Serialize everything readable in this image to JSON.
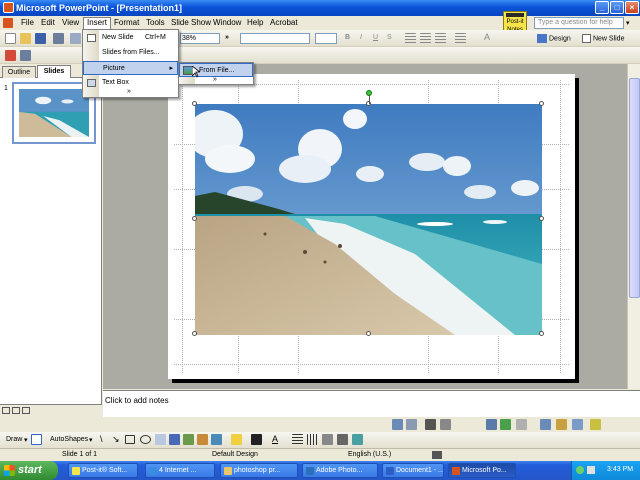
{
  "window": {
    "title": "Microsoft PowerPoint - [Presentation1]",
    "buttons": {
      "minimize": "_",
      "maximize": "□",
      "close": "×"
    }
  },
  "menubar": {
    "items": [
      "File",
      "Edit",
      "View",
      "Insert",
      "Format",
      "Tools",
      "Slide Show",
      "Window",
      "Help",
      "Acrobat"
    ],
    "active": "Insert",
    "help_placeholder": "Type a question for help",
    "postit_label": "Post-it Notes"
  },
  "toolbar": {
    "zoom": "38%",
    "design_label": "Design",
    "new_slide_label": "New Slide"
  },
  "insert_menu": {
    "items": [
      {
        "label": "New Slide",
        "shortcut": "Ctrl+M"
      },
      {
        "label": "Slides from Files...",
        "shortcut": ""
      },
      {
        "label": "Picture",
        "shortcut": ""
      },
      {
        "label": "Text Box",
        "shortcut": ""
      }
    ],
    "expand_glyph": "»"
  },
  "picture_submenu": {
    "items": [
      {
        "label": "From File..."
      }
    ],
    "expand_glyph": "»"
  },
  "left_pane": {
    "tabs": [
      "Outline",
      "Slides"
    ],
    "active_tab": "Slides",
    "close_glyph": "×",
    "slide_number": "1"
  },
  "notes": {
    "placeholder": "Click to add notes"
  },
  "drawing_toolbar": {
    "draw_label": "Draw",
    "autoshapes_label": "AutoShapes"
  },
  "statusbar": {
    "slide_info": "Slide 1 of 1",
    "design": "Default Design",
    "language": "English (U.S.)"
  },
  "taskbar": {
    "start_label": "start",
    "buttons": [
      {
        "label": "Post-it® Soft...",
        "icon_color": "#f6e54a"
      },
      {
        "label": "4 Internet ...",
        "icon_color": "#3a8ce0"
      },
      {
        "label": "photoshop pr...",
        "icon_color": "#e9c66a"
      },
      {
        "label": "Adobe Photo...",
        "icon_color": "#2a6fb8"
      },
      {
        "label": "Document1 - ...",
        "icon_color": "#2b5fc4"
      },
      {
        "label": "Microsoft Po...",
        "icon_color": "#d9531e"
      }
    ],
    "active_button": "Microsoft Po...",
    "clock": "3:43 PM"
  }
}
